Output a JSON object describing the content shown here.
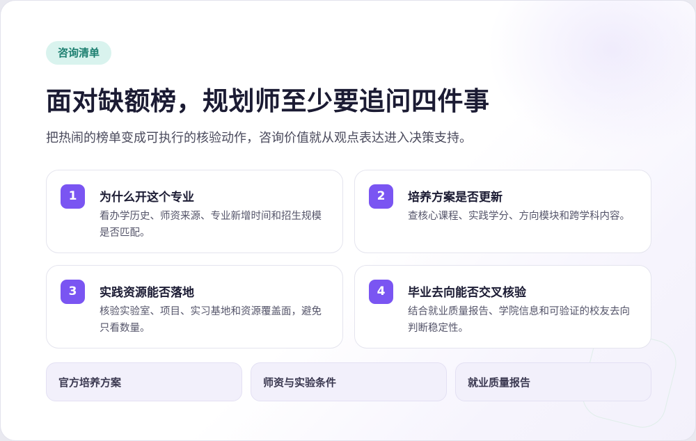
{
  "badge": "咨询清单",
  "title": "面对缺额榜，规划师至少要追问四件事",
  "subtitle": "把热闹的榜单变成可执行的核验动作，咨询价值就从观点表达进入决策支持。",
  "items": [
    {
      "num": "1",
      "title": "为什么开这个专业",
      "desc": "看办学历史、师资来源、专业新增时间和招生规模是否匹配。"
    },
    {
      "num": "2",
      "title": "培养方案是否更新",
      "desc": "查核心课程、实践学分、方向模块和跨学科内容。"
    },
    {
      "num": "3",
      "title": "实践资源能否落地",
      "desc": "核验实验室、项目、实习基地和资源覆盖面，避免只看数量。"
    },
    {
      "num": "4",
      "title": "毕业去向能否交叉核验",
      "desc": "结合就业质量报告、学院信息和可验证的校友去向判断稳定性。"
    }
  ],
  "sources": [
    "官方培养方案",
    "师资与实验条件",
    "就业质量报告"
  ],
  "colors": {
    "accent": "#7a55f2",
    "badge_bg": "#d9f3ee",
    "badge_text": "#1d7f70"
  }
}
